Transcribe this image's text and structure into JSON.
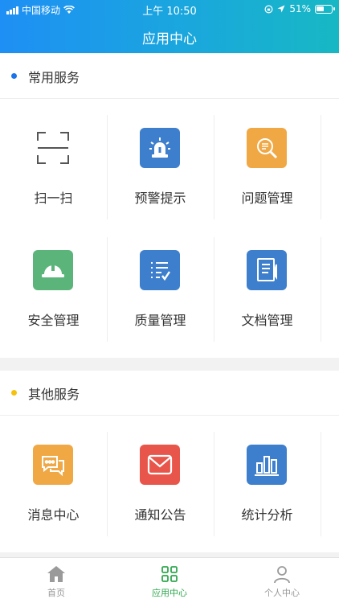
{
  "status_bar": {
    "carrier": "中国移动",
    "time": "上午 10:50",
    "battery": "51%"
  },
  "header": {
    "title": "应用中心"
  },
  "colors": {
    "header_start": "#1e8ff5",
    "header_end": "#17b8c4",
    "common_dot": "#1a73e8",
    "other_dot": "#f4c20d",
    "active_tab": "#2fa84f"
  },
  "common": {
    "title": "常用服务",
    "items": [
      {
        "label": "扫一扫",
        "icon": "scan-icon"
      },
      {
        "label": "预警提示",
        "icon": "alarm-light-icon",
        "color": "#3d7fcc"
      },
      {
        "label": "问题管理",
        "icon": "magnifier-doc-icon",
        "color": "#f0a845"
      },
      {
        "label": "安全管理",
        "icon": "hard-hat-icon",
        "color": "#5bb57a"
      },
      {
        "label": "质量管理",
        "icon": "checklist-icon",
        "color": "#3d7fcc"
      },
      {
        "label": "文档管理",
        "icon": "document-icon",
        "color": "#3d7fcc"
      }
    ]
  },
  "other": {
    "title": "其他服务",
    "items": [
      {
        "label": "消息中心",
        "icon": "chat-bubbles-icon",
        "color": "#f0a845"
      },
      {
        "label": "通知公告",
        "icon": "envelope-icon",
        "color": "#e8554a"
      },
      {
        "label": "统计分析",
        "icon": "bar-chart-icon",
        "color": "#3d7fcc"
      }
    ]
  },
  "tabbar": {
    "items": [
      {
        "label": "首页"
      },
      {
        "label": "应用中心"
      },
      {
        "label": "个人中心"
      }
    ]
  }
}
